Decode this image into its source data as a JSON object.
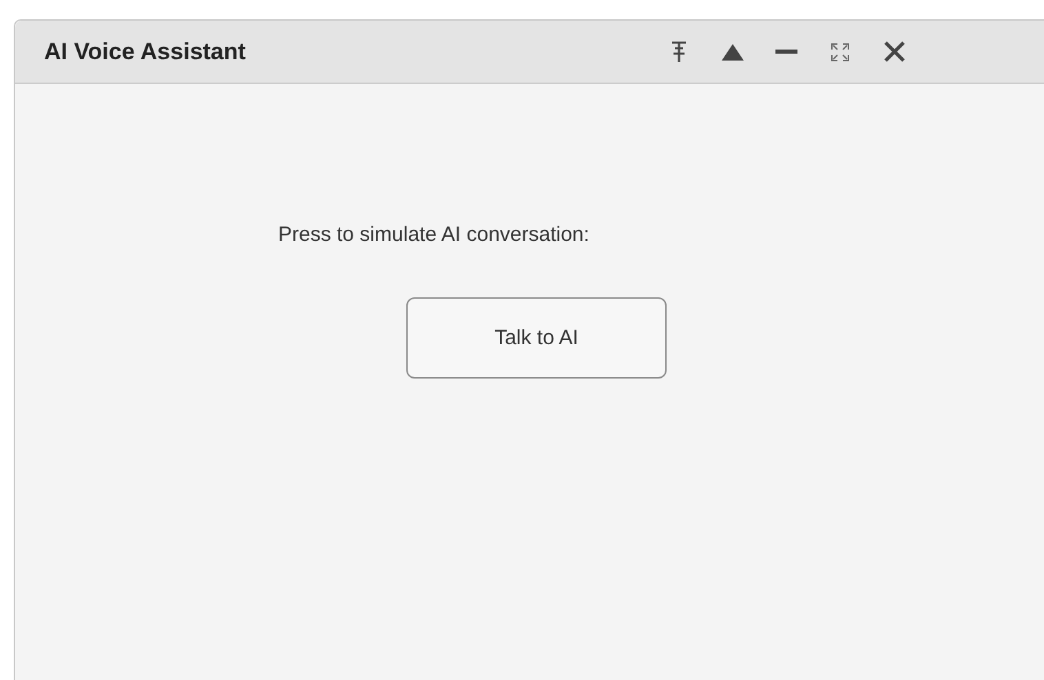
{
  "window": {
    "title": "AI Voice Assistant"
  },
  "prompt": "Press to simulate AI conversation:",
  "button": "Talk to AI"
}
